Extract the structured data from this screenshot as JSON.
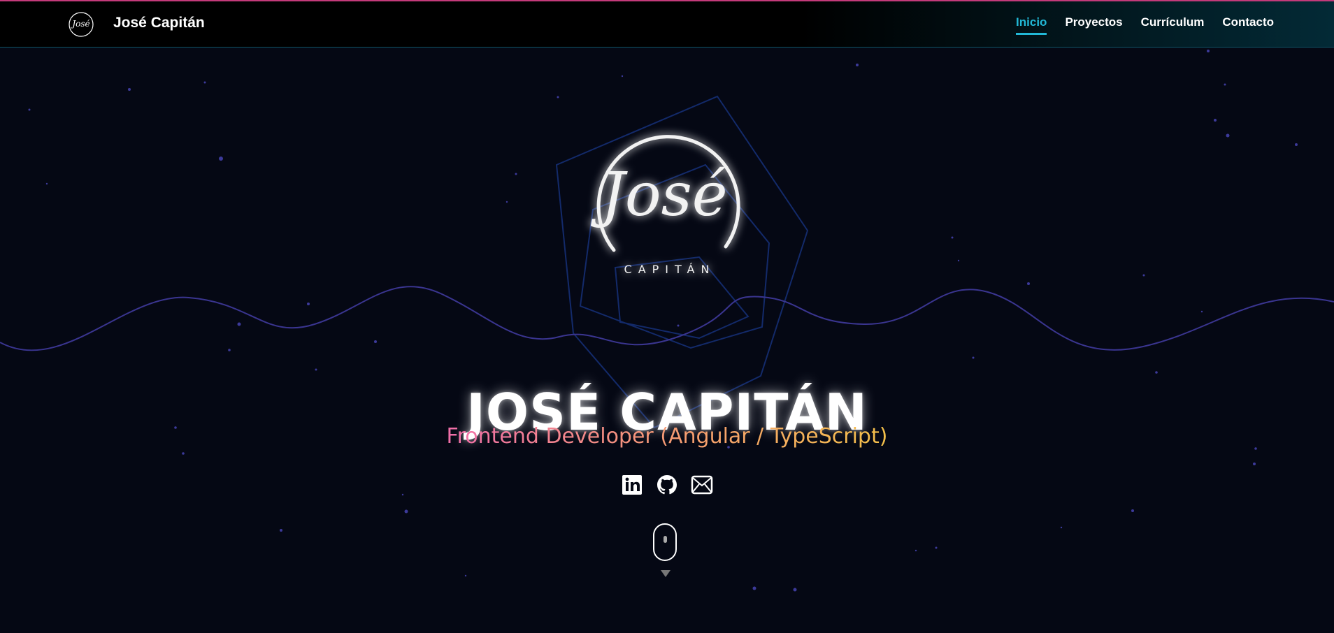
{
  "header": {
    "brand_name": "José Capitán",
    "logo_icon": "jose-signature-logo-icon",
    "nav": [
      {
        "label": "Inicio",
        "active": true
      },
      {
        "label": "Proyectos",
        "active": false
      },
      {
        "label": "Currículum",
        "active": false
      },
      {
        "label": "Contacto",
        "active": false
      }
    ]
  },
  "hero": {
    "logo_script": "José",
    "logo_sub": "CAPITÁN",
    "title": "JOSÉ CAPITÁN",
    "subtitle": "Frontend Developer (Angular / TypeScript)",
    "socials": [
      {
        "icon": "linkedin-icon"
      },
      {
        "icon": "github-icon"
      },
      {
        "icon": "email-icon"
      }
    ],
    "scroll_indicator": "mouse-scroll-icon"
  },
  "colors": {
    "background": "#050814",
    "accent": "#22b8d6",
    "wave": "#3a3590",
    "subtitle_gradient": [
      "#f06ea9",
      "#f4c04a"
    ]
  }
}
